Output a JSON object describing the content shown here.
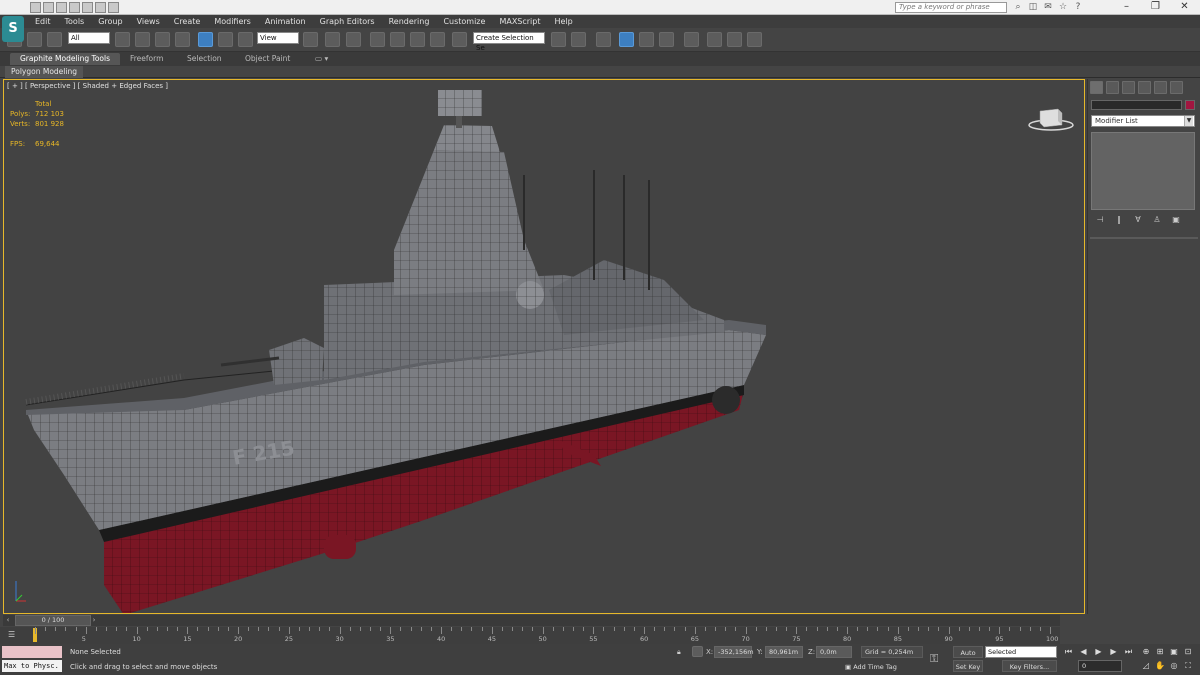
{
  "window": {
    "search_placeholder": "Type a keyword or phrase",
    "app_logo": "3ds-max-logo"
  },
  "menu": {
    "items": [
      "Edit",
      "Tools",
      "Group",
      "Views",
      "Create",
      "Modifiers",
      "Animation",
      "Graph Editors",
      "Rendering",
      "Customize",
      "MAXScript",
      "Help"
    ]
  },
  "toolbar": {
    "selection_filter": "All",
    "reference_coord": "View",
    "named_selection": "Create Selection Se"
  },
  "ribbon": {
    "tabs": [
      "Graphite Modeling Tools",
      "Freeform",
      "Selection",
      "Object Paint"
    ],
    "active_panel": "Polygon Modeling"
  },
  "viewport": {
    "label": "[ + ] [ Perspective ] [ Shaded + Edged Faces ]",
    "stats": {
      "header": "Total",
      "polys_label": "Polys:",
      "polys_value": "712 103",
      "verts_label": "Verts:",
      "verts_value": "801 928",
      "fps_label": "FPS:",
      "fps_value": "69,644"
    },
    "hull_number": "F 215",
    "colors": {
      "stats": "#e8b726",
      "hull": "#7b7d82",
      "hull_bottom": "#7a1624",
      "selection_border": "#e6b82b"
    }
  },
  "command_panel": {
    "modifier_list": "Modifier List"
  },
  "timeline": {
    "slider_label": "0 / 100",
    "ticks": [
      "5",
      "10",
      "15",
      "20",
      "25",
      "30",
      "35",
      "40",
      "45",
      "50",
      "55",
      "60",
      "65",
      "70",
      "75",
      "80",
      "85",
      "90",
      "95",
      "100"
    ]
  },
  "status": {
    "maxscript_output": "Max to Physc.",
    "selection": "None Selected",
    "prompt": "Click and drag to select and move objects",
    "x_label": "X:",
    "x_value": "-352,156m",
    "y_label": "Y:",
    "y_value": "80,961m",
    "z_label": "Z:",
    "z_value": "0,0m",
    "grid": "Grid = 0,254m",
    "add_time_tag": "Add Time Tag",
    "auto_key": "Auto Key",
    "set_key": "Set Key",
    "key_mode": "Selected",
    "key_filters": "Key Filters...",
    "current_frame": "0"
  }
}
